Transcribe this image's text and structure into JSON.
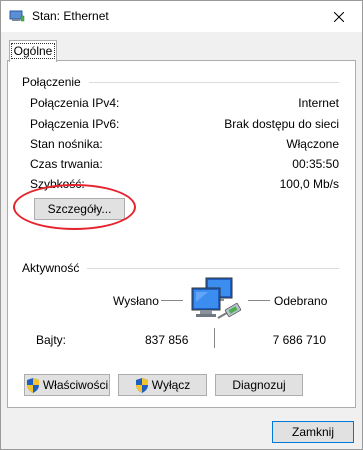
{
  "window": {
    "title": "Stan: Ethernet"
  },
  "tabs": [
    {
      "label": "Ogólne"
    }
  ],
  "connection": {
    "group_title": "Połączenie",
    "rows": [
      {
        "label": "Połączenia IPv4:",
        "value": "Internet"
      },
      {
        "label": "Połączenia IPv6:",
        "value": "Brak dostępu do sieci"
      },
      {
        "label": "Stan nośnika:",
        "value": "Włączone"
      },
      {
        "label": "Czas trwania:",
        "value": "00:35:50"
      },
      {
        "label": "Szybkość:",
        "value": "100,0 Mb/s"
      }
    ],
    "details_button": "Szczegóły..."
  },
  "activity": {
    "group_title": "Aktywność",
    "sent_label": "Wysłano",
    "received_label": "Odebrano",
    "bytes_label": "Bajty:",
    "bytes_sent": "837 856",
    "bytes_received": "7 686 710"
  },
  "actions": {
    "properties": "Właściwości",
    "disable": "Wyłącz",
    "diagnose": "Diagnozuj"
  },
  "footer": {
    "close": "Zamknij"
  },
  "colors": {
    "annotation": "#e5232d",
    "accent_border": "#0078d7"
  },
  "icons": {
    "title": "network-adapter-icon",
    "activity": "network-computers-icon",
    "shield": "uac-shield-icon"
  }
}
